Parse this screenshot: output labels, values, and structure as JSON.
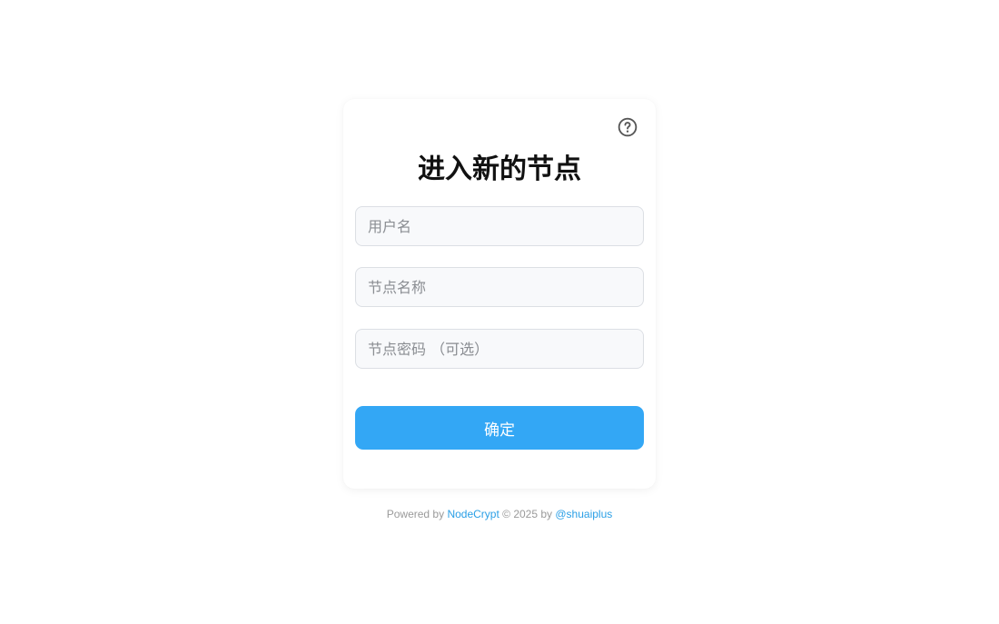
{
  "form": {
    "title": "进入新的节点",
    "username_placeholder": "用户名",
    "node_name_placeholder": "节点名称",
    "node_password_placeholder": "节点密码 （可选）",
    "submit_label": "确定",
    "help_icon": "question-circle-icon"
  },
  "footer": {
    "powered_by": "Powered by",
    "project_link": "NodeCrypt",
    "copyright": "© 2025 by",
    "author_link": "@shuaiplus"
  },
  "colors": {
    "accent": "#33a7f5",
    "link": "#2a9fe6",
    "background": "#ffffff"
  }
}
